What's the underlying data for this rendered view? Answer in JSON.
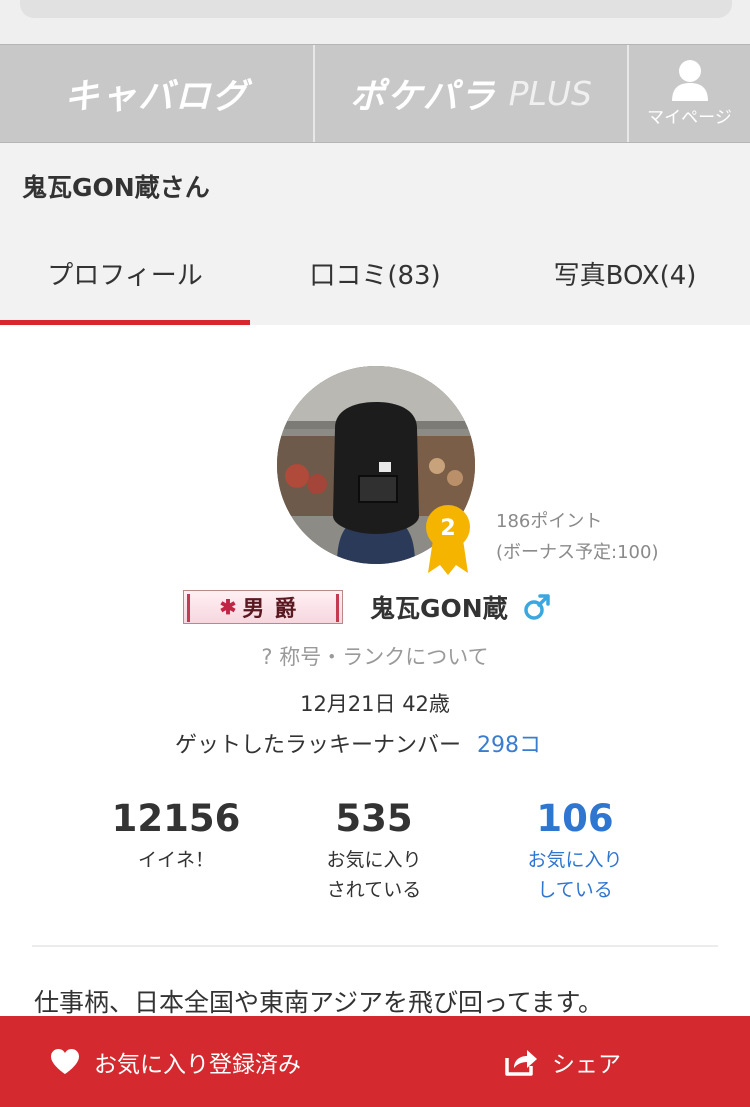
{
  "header": {
    "logo_kyabalog": "キャバログ",
    "logo_pokepara": "ポケパラ",
    "logo_plus": "PLUS",
    "mypage_label": "マイページ"
  },
  "page_title": "鬼瓦GON蔵さん",
  "tabs": [
    {
      "label": "プロフィール",
      "active": true
    },
    {
      "label": "口コミ(83)",
      "active": false
    },
    {
      "label": "写真BOX(4)",
      "active": false
    }
  ],
  "profile": {
    "rank_number": "2",
    "points": "186ポイント",
    "bonus": "(ボーナス予定:100)",
    "title_plate": "男爵",
    "username": "鬼瓦GON蔵",
    "rank_link": "? 称号・ランクについて",
    "birthday_age": "12月21日 42歳",
    "lucky_label": "ゲットしたラッキーナンバー",
    "lucky_count": "298コ",
    "stats": [
      {
        "value": "12156",
        "label": "イイネ！"
      },
      {
        "value": "535",
        "label": "お気に入り\nされている"
      },
      {
        "value": "106",
        "label": "お気に入り\nしている"
      }
    ],
    "bio": "仕事柄、日本全国や東南アジアを飛び回ってます。"
  },
  "footer": {
    "favorite_label": "お気に入り登録済み",
    "share_label": "シェア"
  },
  "colors": {
    "accent_red": "#d42a2f",
    "link_blue": "#2f76d1",
    "badge_gold": "#f5b400",
    "gender_blue": "#3aa7e0"
  }
}
